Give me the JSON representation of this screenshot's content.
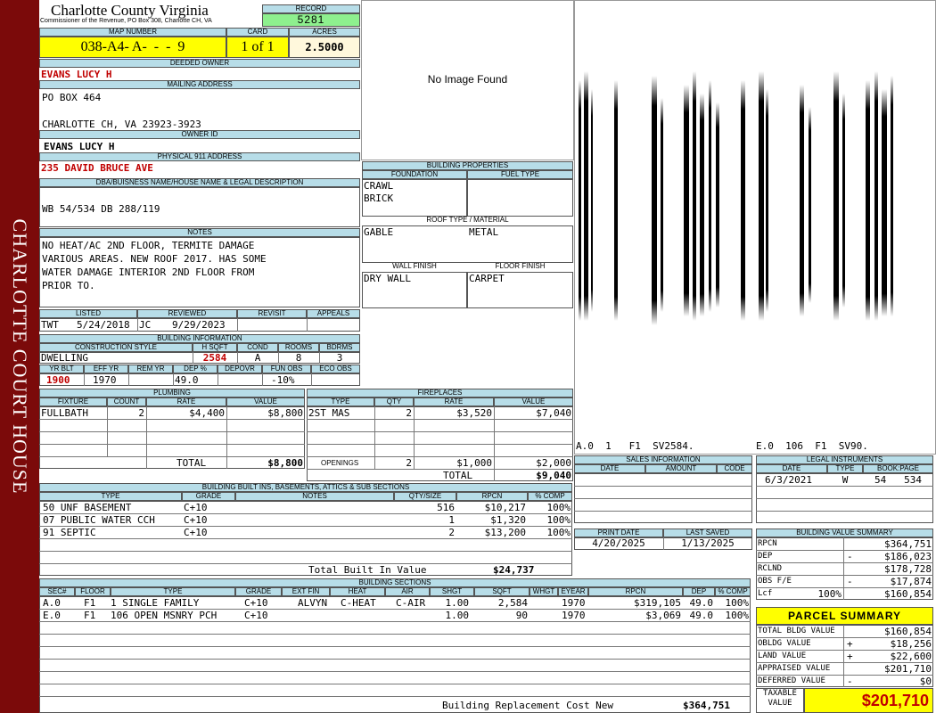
{
  "sidebar": {
    "text": "CHARLOTTE COURT HOUSE"
  },
  "header": {
    "county": "Charlotte County Virginia",
    "office": "Commissioner of the Revenue, PO Box 308, Charlotte CH, VA"
  },
  "record": {
    "label": "RECORD",
    "value": "5281"
  },
  "map": {
    "label": "MAP NUMBER",
    "value": "038-A4- A-  -  -  9"
  },
  "card": {
    "label": "CARD",
    "value": "1 of 1"
  },
  "acres": {
    "label": "ACRES",
    "value": "2.5000"
  },
  "deeded_owner": {
    "label": "DEEDED OWNER",
    "value": "EVANS LUCY H"
  },
  "mailing": {
    "label": "MAILING ADDRESS",
    "line1": "PO BOX 464",
    "line2": "CHARLOTTE CH, VA 23923-3923"
  },
  "owner_id": {
    "label": "OWNER ID",
    "value": "EVANS LUCY H"
  },
  "physical": {
    "label": "PHYSICAL 911 ADDRESS",
    "value": "235 DAVID BRUCE AVE"
  },
  "dba": {
    "label": "DBA/BUISNESS NAME/HOUSE NAME & LEGAL DESCRIPTION",
    "value": "WB 54/534 DB 288/119"
  },
  "notes": {
    "label": "NOTES",
    "lines": [
      "NO HEAT/AC 2ND FLOOR, TERMITE DAMAGE",
      "VARIOUS AREAS. NEW ROOF 2017. HAS SOME",
      "WATER DAMAGE INTERIOR 2ND FLOOR FROM",
      "PRIOR TO."
    ]
  },
  "image": {
    "text": "No Image Found"
  },
  "building_properties": {
    "label": "BUILDING PROPERTIES",
    "foundation_label": "FOUNDATION",
    "fuel_label": "FUEL TYPE",
    "foundation1": "CRAWL",
    "foundation2": "BRICK",
    "roof_label": "ROOF TYPE / MATERIAL",
    "roof_type": "GABLE",
    "roof_material": "METAL",
    "wall_label": "WALL FINISH",
    "floor_label": "FLOOR FINISH",
    "wall": "DRY WALL",
    "floor": "CARPET"
  },
  "listing": {
    "listed_label": "LISTED",
    "reviewed_label": "REVIEWED",
    "revisit_label": "REVISIT",
    "appeals_label": "APPEALS",
    "listed_by": "TWT",
    "listed_date": "5/24/2018",
    "reviewed_by": "JC",
    "reviewed_date": "9/29/2023"
  },
  "building_info": {
    "label": "BUILDING INFORMATION",
    "style_label": "CONSTRUCTION STYLE",
    "hsqft_label": "H SQFT",
    "cond_label": "COND",
    "rooms_label": "ROOMS",
    "bdrms_label": "BDRMS",
    "style": "DWELLING",
    "hsqft": "2584",
    "cond": "A",
    "rooms": "8",
    "bdrms": "3",
    "yrblt_label": "YR BLT",
    "effyr_label": "EFF YR",
    "remyr_label": "REM YR",
    "dep_label": "DEP %",
    "depovr_label": "DEPOVR",
    "funobs_label": "FUN OBS",
    "ecoobs_label": "ECO OBS",
    "yrblt": "1900",
    "effyr": "1970",
    "remyr": "",
    "dep": "49.0",
    "depovr": "",
    "funobs": "-10%",
    "ecoobs": ""
  },
  "plumbing": {
    "label": "PLUMBING",
    "headers": [
      "FIXTURE",
      "COUNT",
      "RATE",
      "VALUE"
    ],
    "rows": [
      {
        "fixture": "FULLBATH",
        "count": "2",
        "rate": "$4,400",
        "value": "$8,800"
      }
    ],
    "total_label": "TOTAL",
    "total": "$8,800"
  },
  "fireplaces": {
    "label": "FIREPLACES",
    "headers": [
      "TYPE",
      "QTY",
      "RATE",
      "VALUE"
    ],
    "rows": [
      {
        "type": "2ST MAS",
        "qty": "2",
        "rate": "$3,520",
        "value": "$7,040"
      }
    ],
    "openings_label": "OPENINGS",
    "openings_qty": "2",
    "openings_rate": "$1,000",
    "openings_value": "$2,000",
    "total_label": "TOTAL",
    "total": "$9,040"
  },
  "sketch": {
    "left_text": "A.0  1   F1  SV2584.",
    "right_text": "E.0  106  F1  SV90."
  },
  "sales": {
    "label": "SALES INFORMATION",
    "headers": [
      "DATE",
      "AMOUNT",
      "CODE"
    ]
  },
  "legal": {
    "label": "LEGAL INSTRUMENTS",
    "headers": [
      "DATE",
      "TYPE",
      "BOOK:PAGE"
    ],
    "date": "6/3/2021",
    "type": "W",
    "bookpage": "54   534"
  },
  "print": {
    "print_label": "PRINT DATE",
    "saved_label": "LAST SAVED",
    "print_date": "4/20/2025",
    "saved_date": "1/13/2025"
  },
  "builtins": {
    "label": "BUILDING BUILT INS, BASEMENTS, ATTICS & SUB SECTIONS",
    "headers": [
      "TYPE",
      "GRADE",
      "NOTES",
      "QTY/SIZE",
      "RPCN",
      "% COMP"
    ],
    "rows": [
      {
        "type": "50 UNF BASEMENT",
        "grade": "C+10",
        "notes": "",
        "qty": "516",
        "rpcn": "$10,217",
        "comp": "100%"
      },
      {
        "type": "07 PUBLIC WATER CCH",
        "grade": "C+10",
        "notes": "",
        "qty": "1",
        "rpcn": "$1,320",
        "comp": "100%"
      },
      {
        "type": "91 SEPTIC",
        "grade": "C+10",
        "notes": "",
        "qty": "2",
        "rpcn": "$13,200",
        "comp": "100%"
      }
    ],
    "total_label": "Total Built In Value",
    "total": "$24,737"
  },
  "value_summary": {
    "label": "BUILDING VALUE SUMMARY",
    "rpcn_label": "RPCN",
    "rpcn": "$364,751",
    "dep_label": "DEP",
    "dep_sign": "-",
    "dep": "$186,023",
    "rclnd_label": "RCLND",
    "rclnd": "$178,728",
    "obs_label": "OBS F/E",
    "obs_sign": "-",
    "obs": "$17,874",
    "lcf_label": "Lcf",
    "lcf_pct": "100%",
    "lcf": "$160,854"
  },
  "sections": {
    "label": "BUILDING SECTIONS",
    "headers": [
      "SEC#",
      "FLOOR",
      "TYPE",
      "GRADE",
      "EXT FIN",
      "HEAT",
      "AIR",
      "SHGT",
      "SQFT",
      "WHGT",
      "EYEAR",
      "RPCN",
      "DEP",
      "% COMP"
    ],
    "rows": [
      {
        "sec": "A.0",
        "floor": "F1",
        "type": "1 SINGLE FAMILY",
        "grade": "C+10",
        "extfin": "ALVYN",
        "heat": "C-HEAT",
        "air": "C-AIR",
        "shgt": "1.00",
        "sqft": "2,584",
        "whgt": "",
        "eyear": "1970",
        "rpcn": "$319,105",
        "dep": "49.0",
        "comp": "100%"
      },
      {
        "sec": "E.0",
        "floor": "F1",
        "type": "106 OPEN MSNRY PCH",
        "grade": "C+10",
        "extfin": "",
        "heat": "",
        "air": "",
        "shgt": "1.00",
        "sqft": "90",
        "whgt": "",
        "eyear": "1970",
        "rpcn": "$3,069",
        "dep": "49.0",
        "comp": "100%"
      }
    ],
    "replacement_label": "Building Replacement Cost New",
    "replacement": "$364,751"
  },
  "parcel": {
    "label": "PARCEL SUMMARY",
    "total_bldg_label": "TOTAL BLDG VALUE",
    "total_bldg": "$160,854",
    "obldg_label": "OBLDG VALUE",
    "obldg_sign": "+",
    "obldg": "$18,256",
    "land_label": "LAND VALUE",
    "land_sign": "+",
    "land": "$22,600",
    "appraised_label": "APPRAISED VALUE",
    "appraised": "$201,710",
    "deferred_label": "DEFERRED VALUE",
    "deferred_sign": "-",
    "deferred": "$0",
    "taxable_label1": "TAXABLE",
    "taxable_label2": "VALUE",
    "taxable": "$201,710"
  },
  "colors": {
    "maroon": "#7b0a0a",
    "yellow": "#ffff00",
    "green": "#8ef08e",
    "label_blue": "#b7dde8",
    "red_text": "#c00000"
  }
}
